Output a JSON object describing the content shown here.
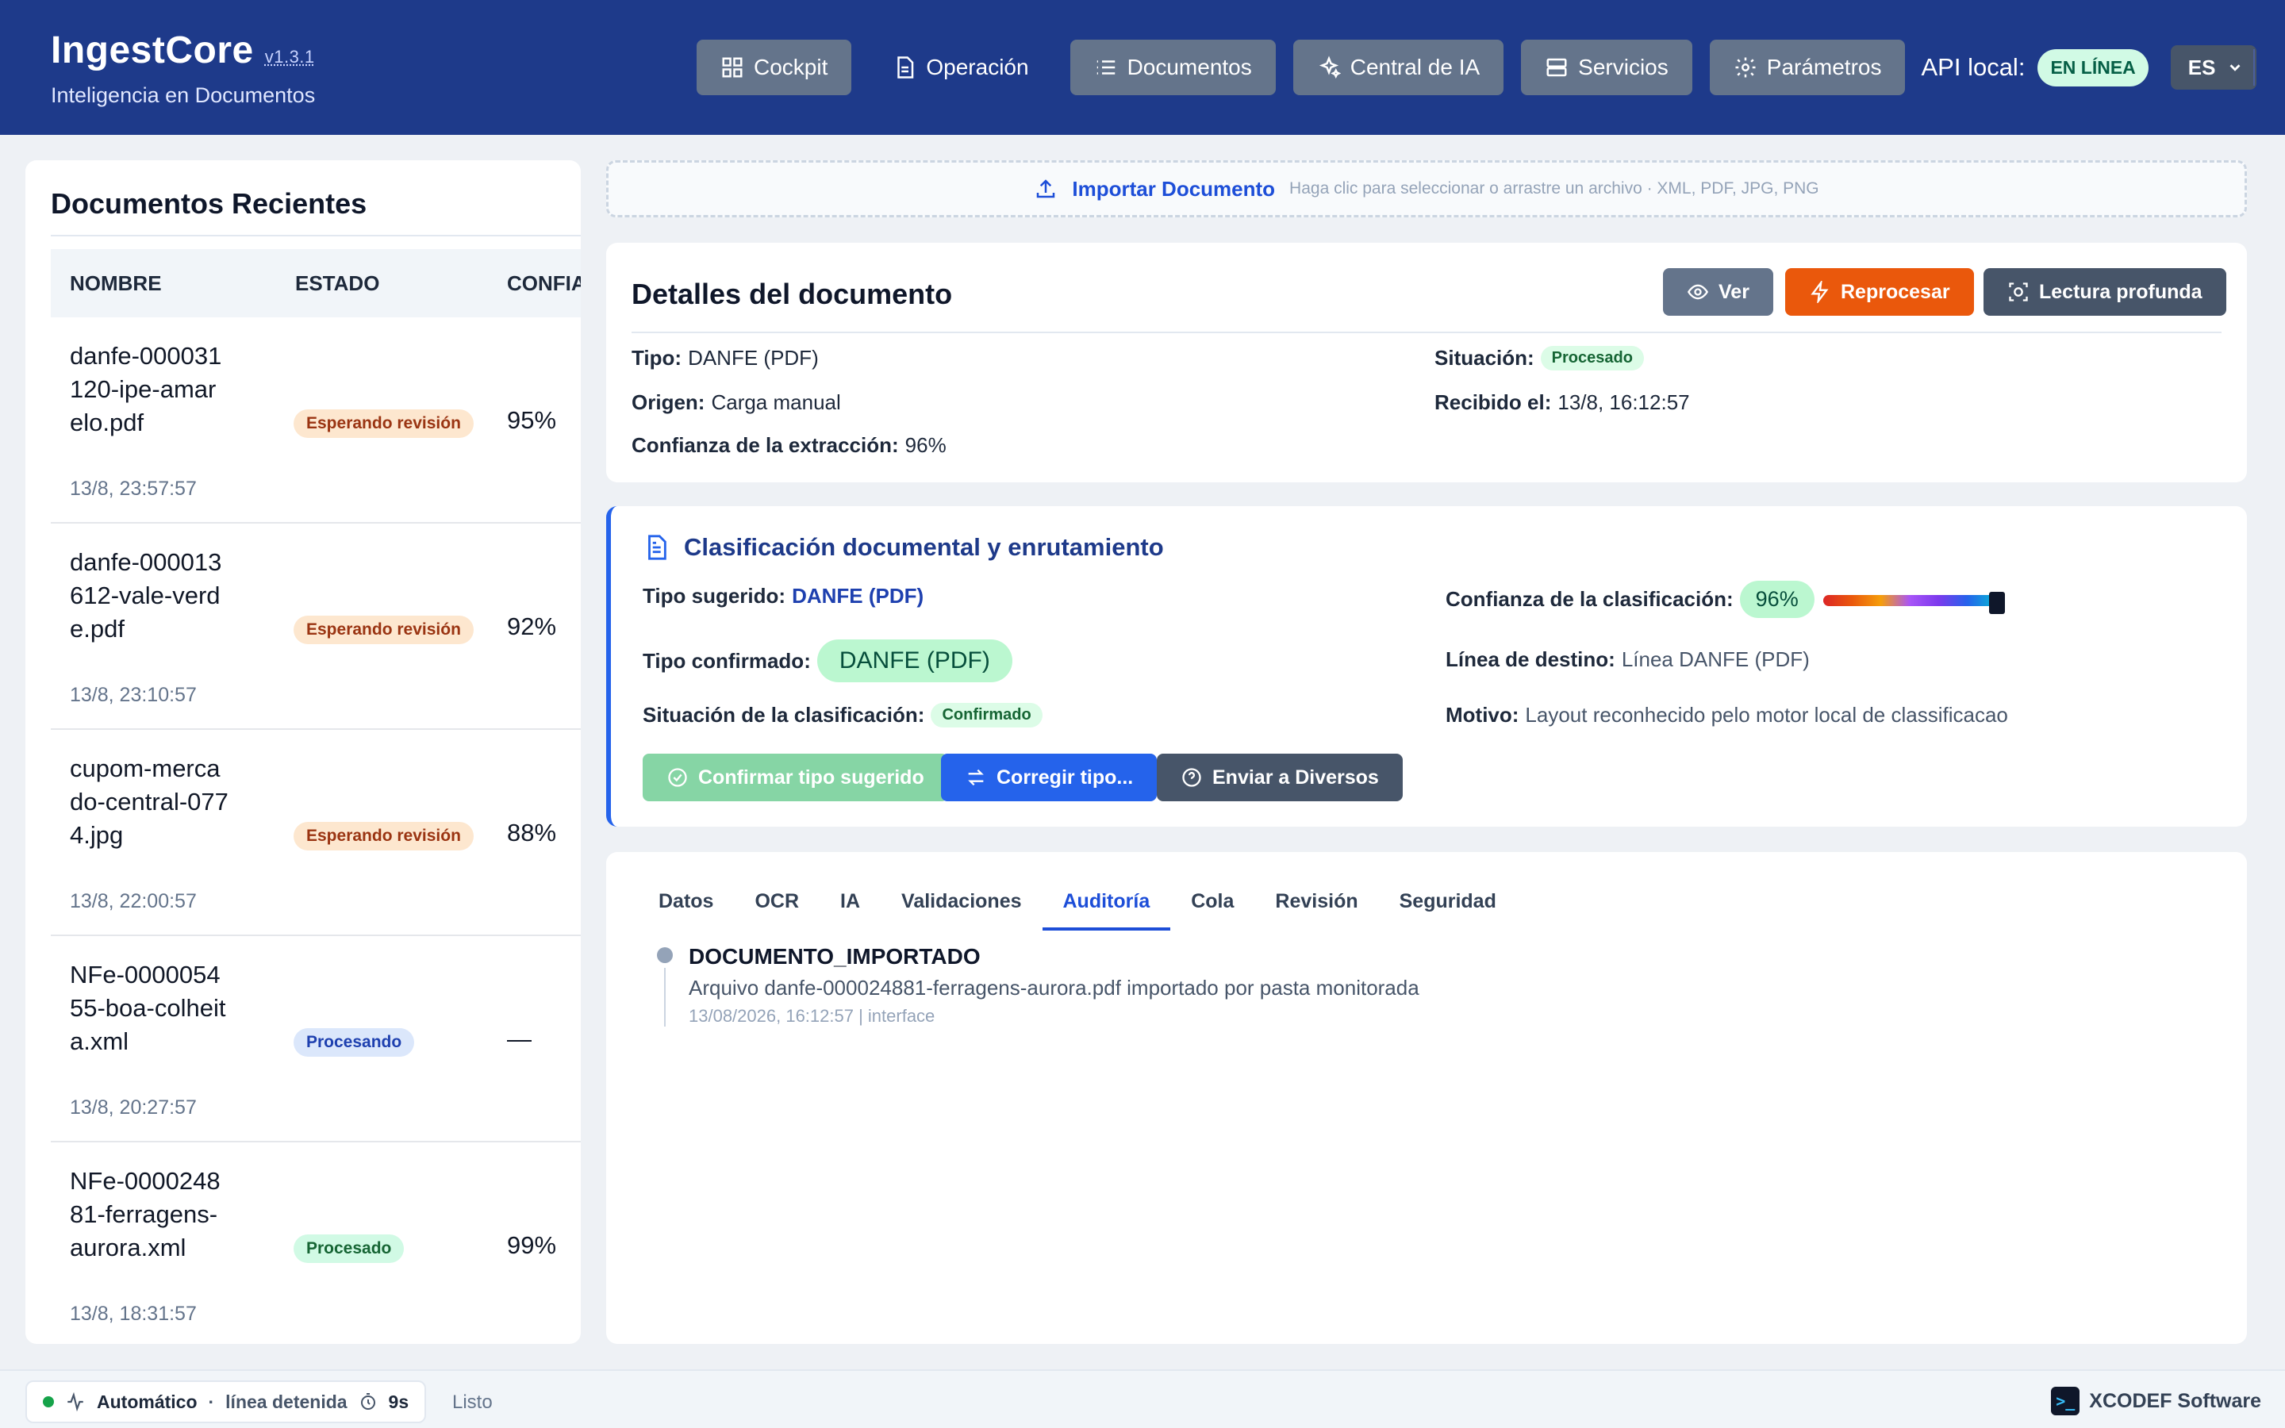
{
  "header": {
    "brand_title": "IngestCore",
    "brand_version": "v1.3.1",
    "brand_subtitle": "Inteligencia en Documentos",
    "nav": [
      {
        "label": "Cockpit",
        "icon": "grid-icon"
      },
      {
        "label": "Operación",
        "icon": "document-icon"
      },
      {
        "label": "Documentos",
        "icon": "list-icon"
      },
      {
        "label": "Central de IA",
        "icon": "sparkles-icon"
      },
      {
        "label": "Servicios",
        "icon": "server-icon"
      },
      {
        "label": "Parámetros",
        "icon": "gear-icon"
      }
    ],
    "api_label": "API local:",
    "api_status": "EN LÍNEA",
    "language": "ES"
  },
  "recent": {
    "title": "Documentos Recientes",
    "columns": [
      "NOMBRE",
      "ESTADO",
      "CONFIA"
    ],
    "rows": [
      {
        "name": "danfe-000031120-ipe-amarelo.pdf",
        "date": "13/8, 23:57:57",
        "status": "Esperando revisión",
        "confidence": "95%"
      },
      {
        "name": "danfe-000013612-vale-verde.pdf",
        "date": "13/8, 23:10:57",
        "status": "Esperando revisión",
        "confidence": "92%"
      },
      {
        "name": "cupom-mercado-central-0774.jpg",
        "date": "13/8, 22:00:57",
        "status": "Esperando revisión",
        "confidence": "88%"
      },
      {
        "name": "NFe-000005455-boa-colheita.xml",
        "date": "13/8, 20:27:57",
        "status": "Procesando",
        "confidence": "—"
      },
      {
        "name": "NFe-000024881-ferragens-aurora.xml",
        "date": "13/8, 18:31:57",
        "status": "Procesado",
        "confidence": "99%"
      }
    ]
  },
  "upload": {
    "label": "Importar Documento",
    "hint": "Haga clic para seleccionar o arrastre un archivo · XML, PDF, JPG, PNG"
  },
  "details": {
    "title": "Detalles del documento",
    "buttons": {
      "view": "Ver",
      "reprocess": "Reprocesar",
      "deep_read": "Lectura profunda"
    },
    "type_label": "Tipo:",
    "type_value": "DANFE (PDF)",
    "origin_label": "Origen:",
    "origin_value": "Carga manual",
    "confidence_label": "Confianza de la extracción:",
    "confidence_value": "96%",
    "status_label": "Situación:",
    "status_value": "Procesado",
    "received_label": "Recibido el:",
    "received_value": "13/8, 16:12:57"
  },
  "classification": {
    "title": "Clasificación documental y enrutamiento",
    "suggested_label": "Tipo sugerido:",
    "suggested_value": "DANFE (PDF)",
    "confirmed_label": "Tipo confirmado:",
    "confirmed_value": "DANFE (PDF)",
    "status_label": "Situación de la clasificación:",
    "status_value": "Confirmado",
    "confidence_label": "Confianza de la clasificación:",
    "confidence_value": "96%",
    "confidence_fraction": 0.96,
    "line_label": "Línea de destino:",
    "line_value": "Línea DANFE (PDF)",
    "reason_label": "Motivo:",
    "reason_value": "Layout reconhecido pelo motor local de classificacao",
    "buttons": {
      "confirm": "Confirmar tipo sugerido",
      "correct": "Corregir tipo...",
      "send": "Enviar a Diversos"
    }
  },
  "tabs": {
    "items": [
      "Datos",
      "OCR",
      "IA",
      "Validaciones",
      "Auditoría",
      "Cola",
      "Revisión",
      "Seguridad"
    ],
    "active": "Auditoría"
  },
  "audit": {
    "event": "DOCUMENTO_IMPORTADO",
    "description": "Arquivo danfe-000024881-ferragens-aurora.pdf importado por pasta monitorada",
    "meta": "13/08/2026, 16:12:57 | interface"
  },
  "statusbar": {
    "mode": "Automático",
    "line_state": "línea detenida",
    "timer": "9s",
    "ready": "Listo",
    "brand": "XCODEF Software"
  },
  "colors": {
    "header_bg": "#1e3a8a",
    "accent_blue": "#2563eb",
    "accent_orange": "#ea580c",
    "success": "#16a34a"
  }
}
